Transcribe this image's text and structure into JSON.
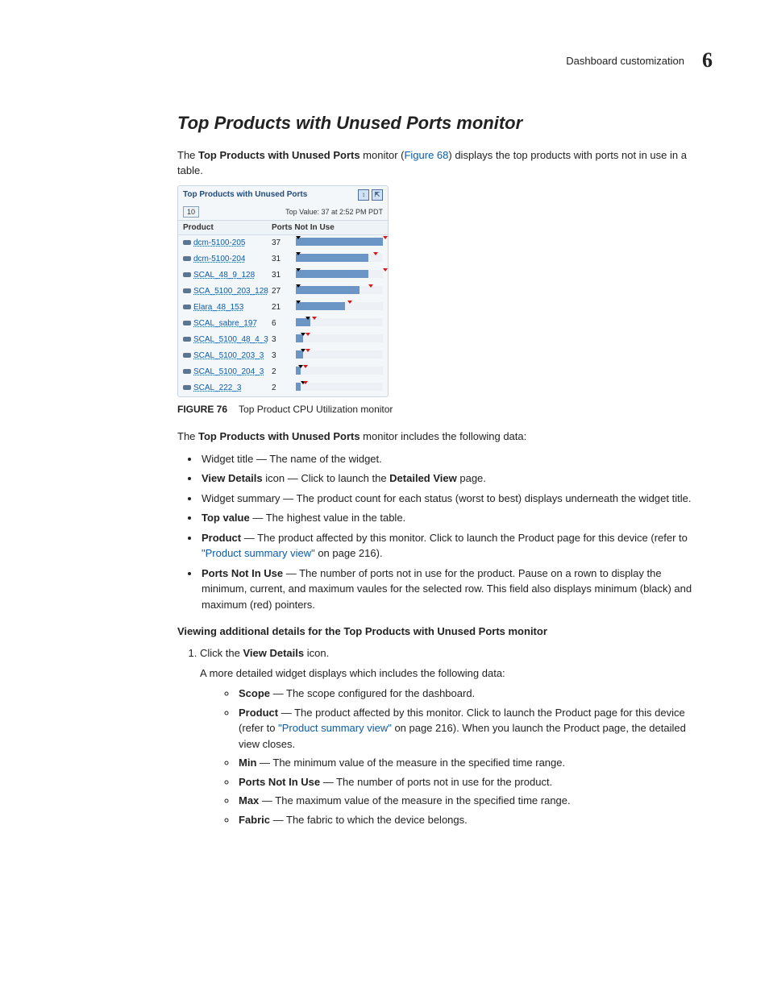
{
  "runningHead": {
    "label": "Dashboard customization",
    "chapnum": "6"
  },
  "section": {
    "title": "Top Products with Unused Ports monitor"
  },
  "intro": {
    "pre": "The ",
    "bold": "Top Products with Unused Ports",
    "mid": " monitor (",
    "xref": "Figure 68",
    "post": ") displays the top products with ports not in use in a table."
  },
  "widget": {
    "title": "Top Products with Unused Ports",
    "count": "10",
    "topValue": "Top Value: 37 at 2:52 PM PDT",
    "col1": "Product",
    "col2": "Ports Not In Use",
    "max": 37,
    "rows": [
      {
        "name": "dcm-5100-205",
        "value": 37,
        "min": 0,
        "rmax": 37
      },
      {
        "name": "dcm-5100-204",
        "value": 31,
        "min": 0,
        "rmax": 33
      },
      {
        "name": "SCAL_48_9_128",
        "value": 31,
        "min": 0,
        "rmax": 37
      },
      {
        "name": "SCA_5100_203_128",
        "value": 27,
        "min": 0,
        "rmax": 31
      },
      {
        "name": "Elara_48_153",
        "value": 21,
        "min": 0,
        "rmax": 22
      },
      {
        "name": "SCAL_sabre_197",
        "value": 6,
        "min": 4,
        "rmax": 7
      },
      {
        "name": "SCAL_5100_48_4_3",
        "value": 3,
        "min": 2,
        "rmax": 4
      },
      {
        "name": "SCAL_5100_203_3",
        "value": 3,
        "min": 2,
        "rmax": 4
      },
      {
        "name": "SCAL_5100_204_3",
        "value": 2,
        "min": 1,
        "rmax": 3
      },
      {
        "name": "SCAL_222_3",
        "value": 2,
        "min": 2,
        "rmax": 3
      }
    ]
  },
  "figureCaption": {
    "num": "FIGURE 76",
    "text": "Top Product CPU Utilization monitor"
  },
  "para2": {
    "pre": "The ",
    "bold": "Top Products with Unused Ports",
    "post": " monitor includes the following data:"
  },
  "list1": [
    {
      "plain": "Widget title — The name of the widget."
    },
    {
      "bold": "View Details",
      "mid": " icon — Click to launch the ",
      "bold2": "Detailed View",
      "post": " page."
    },
    {
      "plain": "Widget summary — The product count for each status (worst to best) displays underneath the widget title."
    },
    {
      "bold": "Top value",
      "post": " — The highest value in the table."
    },
    {
      "bold": "Product",
      "mid": " — The product affected by this monitor. Click to launch the Product page for this device (refer to ",
      "xref": "\"Product summary view\"",
      "post": " on page 216)."
    },
    {
      "bold": "Ports Not In Use",
      "post": " — The number of ports not in use for the product. Pause on a rown to display the minimum, current, and maximum vaules for the selected row. This field also displays minimum (black) and maximum (red) pointers."
    }
  ],
  "subhead": "Viewing additional details for the Top Products with Unused Ports monitor",
  "step1": {
    "pre": "Click the ",
    "bold": "View Details",
    "post": " icon."
  },
  "step1body": "A more detailed widget displays which includes the following data:",
  "list2": [
    {
      "bold": "Scope",
      "post": " — The scope configured for the dashboard."
    },
    {
      "bold": "Product",
      "mid": " — The product affected by this monitor. Click to launch the Product page for this device (refer to ",
      "xref": "\"Product summary view\"",
      "post": " on page 216). When you launch the Product page, the detailed view closes."
    },
    {
      "bold": "Min",
      "post": " — The minimum value of the measure in the specified time range."
    },
    {
      "bold": "Ports Not In Use",
      "post": " — The number of ports not in use for the product."
    },
    {
      "bold": "Max",
      "post": " — The maximum value of the measure in the specified time range."
    },
    {
      "bold": "Fabric",
      "post": " — The fabric to which the device belongs."
    }
  ],
  "chart_data": {
    "type": "bar",
    "title": "Top Products with Unused Ports",
    "xlabel": "",
    "ylabel": "Ports Not In Use",
    "ylim": [
      0,
      37
    ],
    "categories": [
      "dcm-5100-205",
      "dcm-5100-204",
      "SCAL_48_9_128",
      "SCA_5100_203_128",
      "Elara_48_153",
      "SCAL_sabre_197",
      "SCAL_5100_48_4_3",
      "SCAL_5100_203_3",
      "SCAL_5100_204_3",
      "SCAL_222_3"
    ],
    "values": [
      37,
      31,
      31,
      27,
      21,
      6,
      3,
      3,
      2,
      2
    ],
    "series": [
      {
        "name": "min",
        "values": [
          0,
          0,
          0,
          0,
          0,
          4,
          2,
          2,
          1,
          2
        ]
      },
      {
        "name": "current",
        "values": [
          37,
          31,
          31,
          27,
          21,
          6,
          3,
          3,
          2,
          2
        ]
      },
      {
        "name": "max",
        "values": [
          37,
          33,
          37,
          31,
          22,
          7,
          4,
          4,
          3,
          3
        ]
      }
    ]
  }
}
